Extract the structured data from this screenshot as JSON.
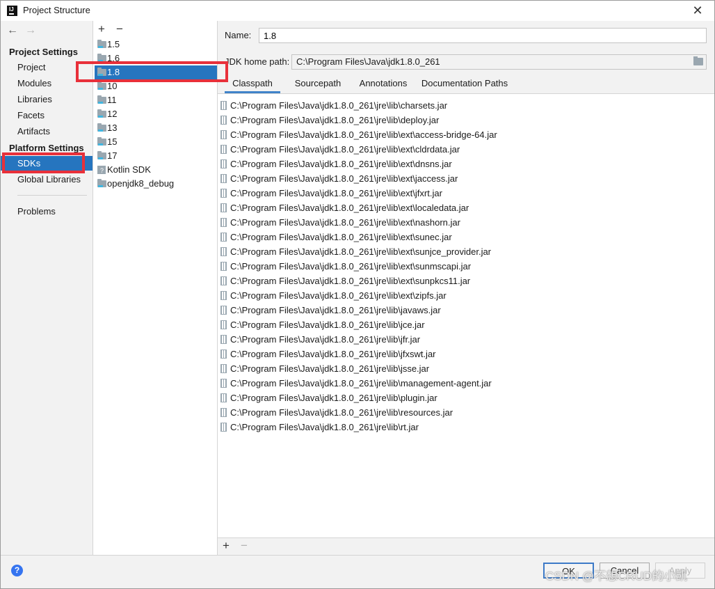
{
  "window": {
    "title": "Project Structure",
    "logo_text": "IJ"
  },
  "leftnav": {
    "back_arrow": "←",
    "forward_arrow": "→",
    "project_settings_header": "Project Settings",
    "project_items": [
      "Project",
      "Modules",
      "Libraries",
      "Facets",
      "Artifacts"
    ],
    "platform_settings_header": "Platform Settings",
    "platform_items": [
      "SDKs",
      "Global Libraries"
    ],
    "selected_item": "SDKs",
    "other_items": [
      "Problems"
    ]
  },
  "sdk_list": {
    "add_label": "+",
    "remove_label": "−",
    "items": [
      "1.5",
      "1.6",
      "1.8",
      "10",
      "11",
      "12",
      "13",
      "15",
      "17",
      "Kotlin SDK",
      "openjdk8_debug"
    ],
    "selected": "1.8"
  },
  "detail": {
    "name_label": "Name:",
    "name_value": "1.8",
    "jdk_home_label": "JDK home path:",
    "jdk_home_value": "C:\\Program Files\\Java\\jdk1.8.0_261",
    "tabs": [
      "Classpath",
      "Sourcepath",
      "Annotations",
      "Documentation Paths"
    ],
    "active_tab": "Classpath",
    "classpath": [
      "C:\\Program Files\\Java\\jdk1.8.0_261\\jre\\lib\\charsets.jar",
      "C:\\Program Files\\Java\\jdk1.8.0_261\\jre\\lib\\deploy.jar",
      "C:\\Program Files\\Java\\jdk1.8.0_261\\jre\\lib\\ext\\access-bridge-64.jar",
      "C:\\Program Files\\Java\\jdk1.8.0_261\\jre\\lib\\ext\\cldrdata.jar",
      "C:\\Program Files\\Java\\jdk1.8.0_261\\jre\\lib\\ext\\dnsns.jar",
      "C:\\Program Files\\Java\\jdk1.8.0_261\\jre\\lib\\ext\\jaccess.jar",
      "C:\\Program Files\\Java\\jdk1.8.0_261\\jre\\lib\\ext\\jfxrt.jar",
      "C:\\Program Files\\Java\\jdk1.8.0_261\\jre\\lib\\ext\\localedata.jar",
      "C:\\Program Files\\Java\\jdk1.8.0_261\\jre\\lib\\ext\\nashorn.jar",
      "C:\\Program Files\\Java\\jdk1.8.0_261\\jre\\lib\\ext\\sunec.jar",
      "C:\\Program Files\\Java\\jdk1.8.0_261\\jre\\lib\\ext\\sunjce_provider.jar",
      "C:\\Program Files\\Java\\jdk1.8.0_261\\jre\\lib\\ext\\sunmscapi.jar",
      "C:\\Program Files\\Java\\jdk1.8.0_261\\jre\\lib\\ext\\sunpkcs11.jar",
      "C:\\Program Files\\Java\\jdk1.8.0_261\\jre\\lib\\ext\\zipfs.jar",
      "C:\\Program Files\\Java\\jdk1.8.0_261\\jre\\lib\\javaws.jar",
      "C:\\Program Files\\Java\\jdk1.8.0_261\\jre\\lib\\jce.jar",
      "C:\\Program Files\\Java\\jdk1.8.0_261\\jre\\lib\\jfr.jar",
      "C:\\Program Files\\Java\\jdk1.8.0_261\\jre\\lib\\jfxswt.jar",
      "C:\\Program Files\\Java\\jdk1.8.0_261\\jre\\lib\\jsse.jar",
      "C:\\Program Files\\Java\\jdk1.8.0_261\\jre\\lib\\management-agent.jar",
      "C:\\Program Files\\Java\\jdk1.8.0_261\\jre\\lib\\plugin.jar",
      "C:\\Program Files\\Java\\jdk1.8.0_261\\jre\\lib\\resources.jar",
      "C:\\Program Files\\Java\\jdk1.8.0_261\\jre\\lib\\rt.jar"
    ],
    "add_label": "+",
    "remove_label": "−"
  },
  "footer": {
    "help_label": "?",
    "ok_label": "OK",
    "cancel_label": "Cancel",
    "apply_label": "Apply"
  },
  "watermark": "CSDN @不想CRUD的小凯",
  "colors": {
    "selection": "#2675bf",
    "annotation_highlight": "#e8303a",
    "tab_underline": "#4083c9"
  }
}
